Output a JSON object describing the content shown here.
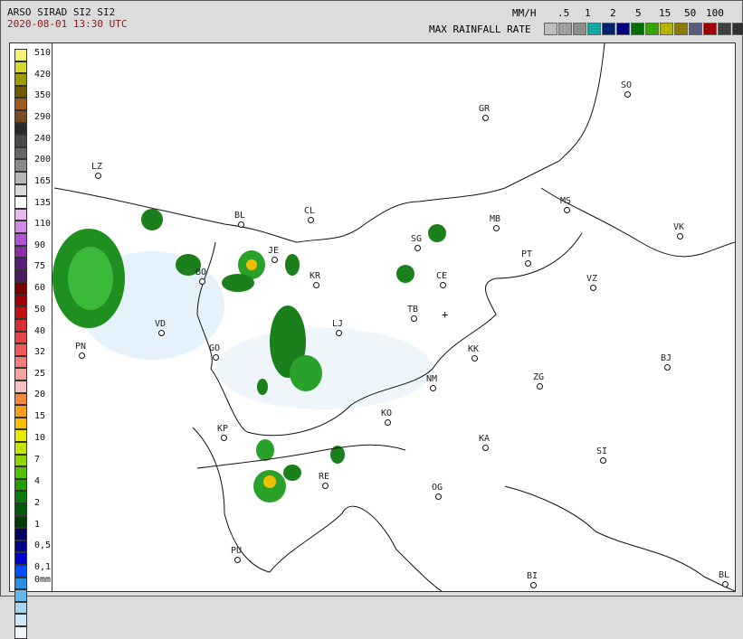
{
  "header": {
    "product": "ARSO SIRAD SI2 SI2",
    "timestamp": "2020-08-01 13:30 UTC",
    "unit_label": "MM/H",
    "rate_title": "MAX RAINFALL RATE"
  },
  "top_scale": {
    "labels": [
      ".5",
      "1",
      "2",
      "5",
      "15",
      "50",
      "100"
    ],
    "colors": [
      "#bdbdbd",
      "#9e9e9e",
      "#8e8e8e",
      "#16a7a7",
      "#002266",
      "#000080",
      "#007000",
      "#3aa000",
      "#b3b300",
      "#8a7a00",
      "#5a5a7a",
      "#a00000",
      "#404040",
      "#303030",
      "#101010"
    ]
  },
  "legend": {
    "unit": "0mm",
    "labels": [
      "510",
      "420",
      "350",
      "290",
      "240",
      "200",
      "165",
      "135",
      "110",
      "90",
      "75",
      "60",
      "50",
      "40",
      "32",
      "25",
      "20",
      "15",
      "10",
      "7",
      "4",
      "2",
      "1",
      "0,5",
      "0,1"
    ],
    "colors": [
      "#f3f37a",
      "#d7d92a",
      "#9d9d00",
      "#6e5a00",
      "#a05a1f",
      "#7a4a22",
      "#2a2a2a",
      "#4b4b4b",
      "#666666",
      "#8a8a8a",
      "#b6b6b6",
      "#d9d9d9",
      "#ffffff",
      "#e8b9f1",
      "#d28ae6",
      "#b155d2",
      "#8a2ea9",
      "#5b1f79",
      "#4b1b5f",
      "#7a0000",
      "#a00000",
      "#c01010",
      "#d63030",
      "#e64646",
      "#ef5a5a",
      "#f37d7d",
      "#f5a3a3",
      "#f7c1c1",
      "#f08a40",
      "#f4a020",
      "#f7c000",
      "#e8e800",
      "#c6e600",
      "#92d600",
      "#55c200",
      "#20a000",
      "#0a7a0a",
      "#005a0a",
      "#003a06",
      "#000066",
      "#00008c",
      "#0000cc",
      "#0050ff",
      "#2a8fe0",
      "#63b9e6",
      "#a4d8f0",
      "#cfe8f7",
      "#eef6fb"
    ]
  },
  "cities": [
    {
      "code": "SO"
    },
    {
      "code": "GR"
    },
    {
      "code": "LZ"
    },
    {
      "code": "MS"
    },
    {
      "code": "BL"
    },
    {
      "code": "CL"
    },
    {
      "code": "MB"
    },
    {
      "code": "VK"
    },
    {
      "code": "JE"
    },
    {
      "code": "SG"
    },
    {
      "code": "PT"
    },
    {
      "code": "BO"
    },
    {
      "code": "KR"
    },
    {
      "code": "CE"
    },
    {
      "code": "VZ"
    },
    {
      "code": "TB"
    },
    {
      "code": "VD"
    },
    {
      "code": "LJ"
    },
    {
      "code": "PN"
    },
    {
      "code": "GO"
    },
    {
      "code": "KK"
    },
    {
      "code": "BJ"
    },
    {
      "code": "ZG"
    },
    {
      "code": "NM"
    },
    {
      "code": "KO"
    },
    {
      "code": "KP"
    },
    {
      "code": "KA"
    },
    {
      "code": "SI"
    },
    {
      "code": "RE"
    },
    {
      "code": "OG"
    },
    {
      "code": "PU"
    },
    {
      "code": "BI"
    },
    {
      "code": "BL"
    }
  ]
}
